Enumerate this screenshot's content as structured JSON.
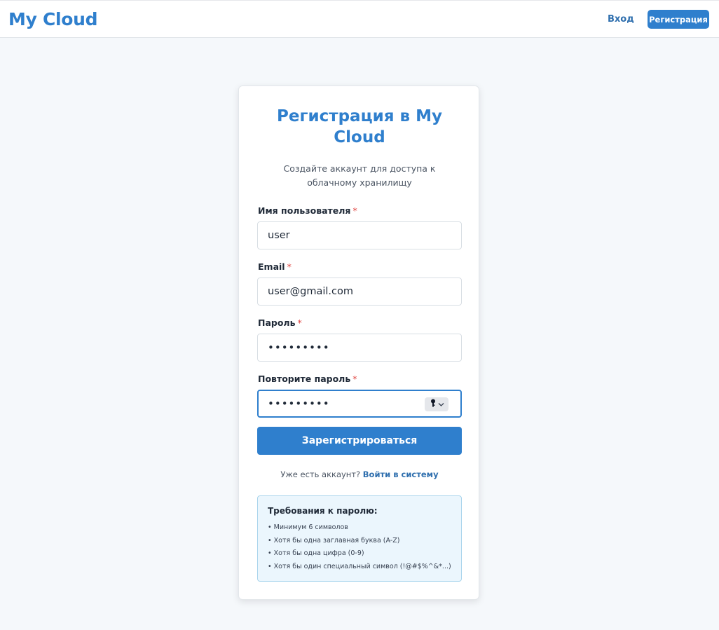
{
  "header": {
    "brand": "My Cloud",
    "login_label": "Вход",
    "register_label": "Регистрация"
  },
  "form": {
    "title": "Регистрация в My Cloud",
    "subtitle": "Создайте аккаунт для доступа к облачному хранилищу",
    "required_mark": "*",
    "username": {
      "label": "Имя пользователя",
      "value": "user"
    },
    "email": {
      "label": "Email",
      "value": "user@gmail.com"
    },
    "password": {
      "label": "Пароль",
      "value": "•••••••••"
    },
    "password_confirm": {
      "label": "Повторите пароль",
      "value": "•••••••••"
    },
    "submit_label": "Зарегистрироваться",
    "have_account_text": "Уже есть аккаунт?",
    "login_link": "Войти в систему"
  },
  "requirements": {
    "title": "Требования к паролю:",
    "items": [
      "• Минимум 6 символов",
      "• Хотя бы одна заглавная буква (A-Z)",
      "• Хотя бы одна цифра (0-9)",
      "• Хотя бы один специальный символ (!@#$%^&*...)"
    ]
  },
  "icons": {
    "password_manager": "key-icon",
    "dropdown": "chevron-down-icon"
  },
  "colors": {
    "accent": "#2f7fcd",
    "required": "#e0433f",
    "info_bg": "#ebf6fd"
  }
}
